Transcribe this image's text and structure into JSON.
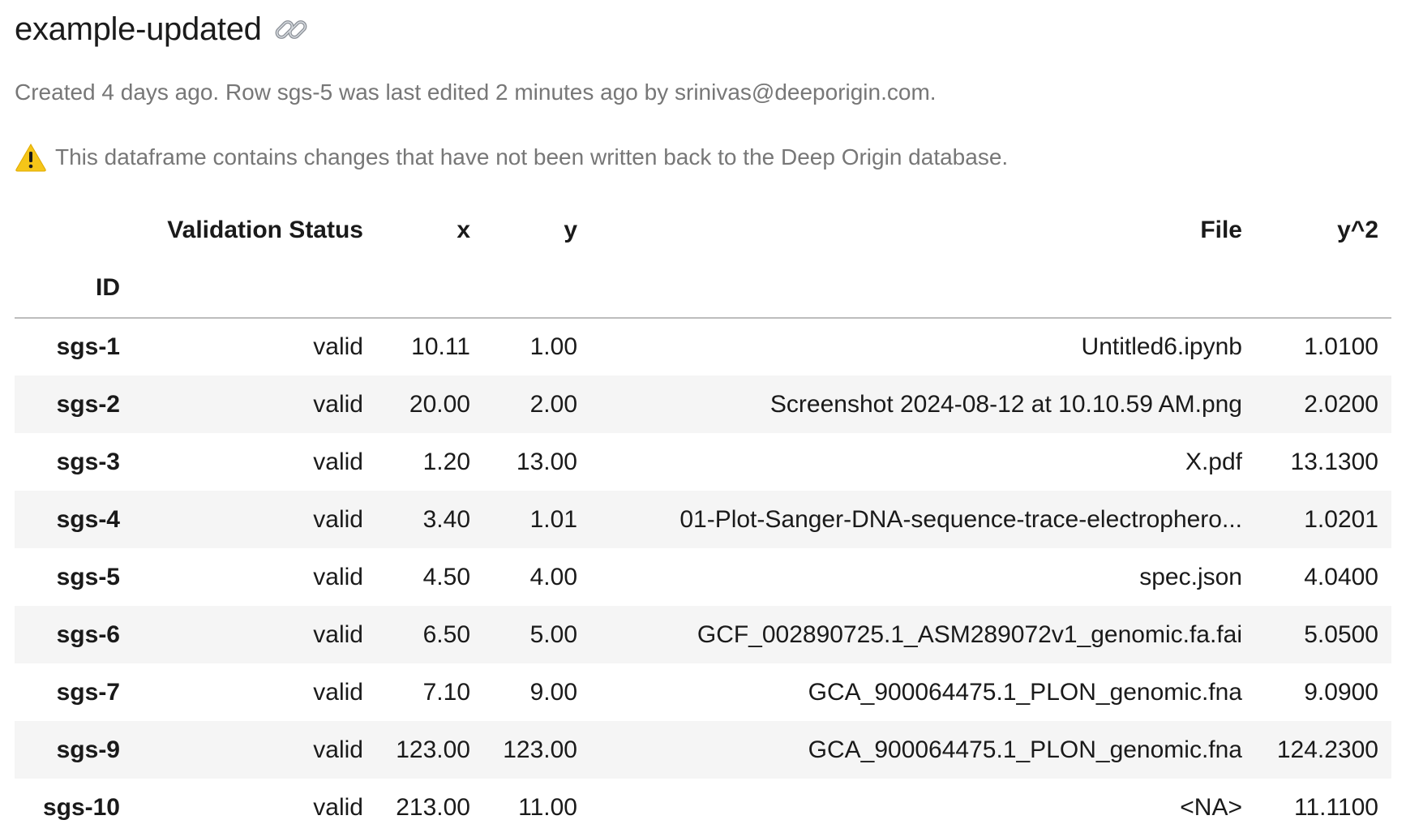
{
  "header": {
    "title": "example-updated",
    "link_icon": "link-icon",
    "meta_text": "Created 4 days ago. Row sgs-5 was last edited 2 minutes ago by srinivas@deeporigin.com.",
    "warning_icon": "warning-icon",
    "warning_text": "This dataframe contains changes that have not been written back to the Deep Origin database."
  },
  "table": {
    "index_name": "ID",
    "columns": [
      "Validation Status",
      "x",
      "y",
      "File",
      "y^2"
    ],
    "rows": [
      {
        "id": "sgs-1",
        "cells": [
          "valid",
          "10.11",
          "1.00",
          "Untitled6.ipynb",
          "1.0100"
        ]
      },
      {
        "id": "sgs-2",
        "cells": [
          "valid",
          "20.00",
          "2.00",
          "Screenshot 2024-08-12 at 10.10.59 AM.png",
          "2.0200"
        ]
      },
      {
        "id": "sgs-3",
        "cells": [
          "valid",
          "1.20",
          "13.00",
          "X.pdf",
          "13.1300"
        ]
      },
      {
        "id": "sgs-4",
        "cells": [
          "valid",
          "3.40",
          "1.01",
          "01-Plot-Sanger-DNA-sequence-trace-electrophero...",
          "1.0201"
        ]
      },
      {
        "id": "sgs-5",
        "cells": [
          "valid",
          "4.50",
          "4.00",
          "spec.json",
          "4.0400"
        ]
      },
      {
        "id": "sgs-6",
        "cells": [
          "valid",
          "6.50",
          "5.00",
          "GCF_002890725.1_ASM289072v1_genomic.fa.fai",
          "5.0500"
        ]
      },
      {
        "id": "sgs-7",
        "cells": [
          "valid",
          "7.10",
          "9.00",
          "GCA_900064475.1_PLON_genomic.fna",
          "9.0900"
        ]
      },
      {
        "id": "sgs-9",
        "cells": [
          "valid",
          "123.00",
          "123.00",
          "GCA_900064475.1_PLON_genomic.fna",
          "124.2300"
        ]
      },
      {
        "id": "sgs-10",
        "cells": [
          "valid",
          "213.00",
          "11.00",
          "<NA>",
          "11.1100"
        ]
      }
    ]
  },
  "colors": {
    "stripe": "#f5f5f5",
    "muted_text": "#777777",
    "warning": "#f5c518"
  }
}
